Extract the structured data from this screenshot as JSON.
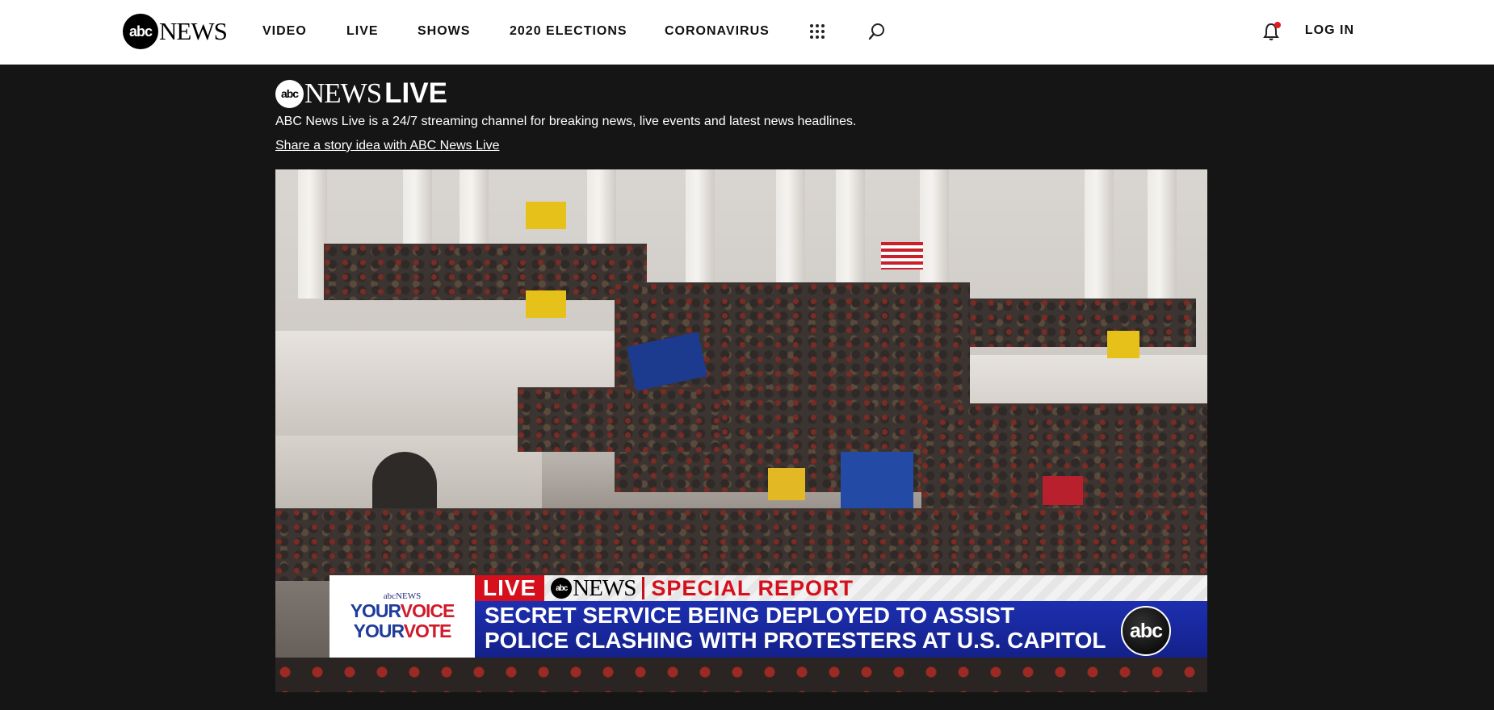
{
  "header": {
    "logo_abc": "abc",
    "logo_news": "NEWS",
    "nav": [
      {
        "label": "VIDEO"
      },
      {
        "label": "LIVE"
      },
      {
        "label": "SHOWS"
      },
      {
        "label": "2020 ELECTIONS"
      },
      {
        "label": "CORONAVIRUS"
      }
    ],
    "icons": [
      "grid-icon",
      "search-icon",
      "bell-icon"
    ],
    "notification_dot_color": "#e21a22",
    "login_label": "LOG IN"
  },
  "live": {
    "logo_abc": "abc",
    "logo_news": "NEWS",
    "logo_live": "LIVE",
    "description": "ABC News Live is a 24/7 streaming channel for breaking news, live events and latest news headlines.",
    "share_link": "Share a story idea with ABC News Live"
  },
  "video": {
    "chyron": {
      "yv_news": "abcNEWS",
      "yv_line1_a": "YOUR",
      "yv_line1_b": "VOICE",
      "yv_line2_a": "YOUR",
      "yv_line2_b": "VOTE",
      "live_label": "LIVE",
      "logo_abc": "abc",
      "logo_news": "NEWS",
      "special_label": "SPECIAL REPORT",
      "headline_line1": "SECRET SERVICE BEING DEPLOYED TO ASSIST",
      "headline_line2": "POLICE CLASHING WITH PROTESTERS AT U.S. CAPITOL",
      "corner_logo": "abc"
    }
  }
}
